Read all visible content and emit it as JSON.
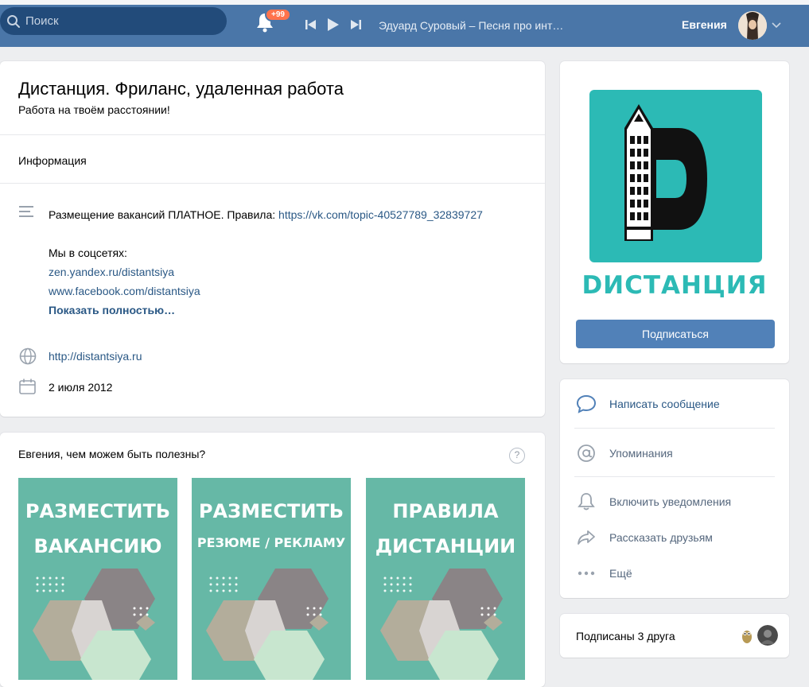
{
  "header": {
    "search_placeholder": "Поиск",
    "notifications_badge": "+99",
    "track": "Эдуард Суровый – Песня про инт…",
    "user_name": "Евгения"
  },
  "group": {
    "title": "Дистанция. Фриланс, удаленная работа",
    "status": "Работа на твоём расстоянии!",
    "info_header": "Информация",
    "desc_line1_text": "Размещение вакансий ПЛАТНОЕ. Правила: ",
    "desc_line1_link": "https://vk.com/topic-40527789_32839727",
    "desc_social_header": "Мы в соцсетях:",
    "desc_social_1": "zen.yandex.ru/distantsiya",
    "desc_social_2": "www.facebook.com/distantsiya",
    "desc_more": "Показать полностью…",
    "website": "http://distantsiya.ru",
    "created": "2 июля 2012"
  },
  "help": {
    "title": "Евгения, чем можем быть полезны?",
    "question_mark": "?",
    "tiles": [
      {
        "line1": "РАЗМЕСТИТЬ",
        "line2": "ВАКАНСИЮ"
      },
      {
        "line1": "РАЗМЕСТИТЬ",
        "line2": "РЕЗЮМЕ / РЕКЛАМУ"
      },
      {
        "line1": "ПРАВИЛА",
        "line2": "ДИСТАНЦИИ"
      }
    ]
  },
  "sidebar": {
    "logo_word": "DИСТАНЦИЯ",
    "subscribe_label": "Подписаться",
    "actions": [
      {
        "label": "Написать сообщение"
      },
      {
        "label": "Упоминания"
      },
      {
        "label": "Включить уведомления"
      },
      {
        "label": "Рассказать друзьям"
      },
      {
        "label": "Ещё"
      }
    ],
    "friends_text": "Подписаны 3 друга"
  },
  "colors": {
    "header_bg": "#4a76a8",
    "link": "#2a5885",
    "button": "#5181b8",
    "logo_teal": "#2cbab5",
    "tile_teal": "#66b8a6"
  }
}
